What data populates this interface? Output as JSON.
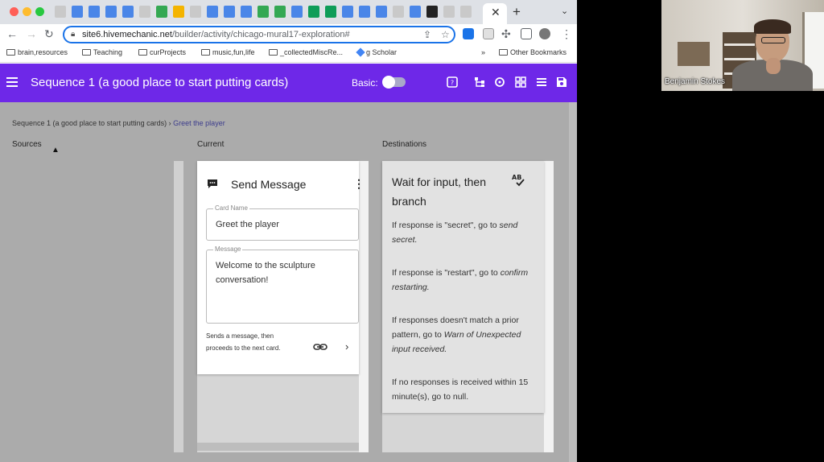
{
  "browser": {
    "url_host": "site6.hivemechanic.net",
    "url_path": "/builder/activity/chicago-mural17-exploration#",
    "bookmarks": [
      "brain,resources",
      "Teaching",
      "curProjects",
      "music,fun,life",
      "_collectedMiscRe...",
      "g Scholar",
      "»",
      "Other Bookmarks"
    ]
  },
  "app": {
    "title": "Sequence 1 (a good place to start putting cards)",
    "basic_label": "Basic:",
    "basic_toggle": "off",
    "accent_color": "#6e28e8"
  },
  "breadcrumb": {
    "parent": "Sequence 1 (a good place to start putting cards)",
    "separator": "›",
    "current": "Greet the player"
  },
  "columns": {
    "sources": "Sources",
    "current": "Current",
    "destinations": "Destinations"
  },
  "current_card": {
    "title": "Send Message",
    "icon": "chat-bubble-icon",
    "card_name_label": "Card Name",
    "card_name_value": "Greet the player",
    "message_label": "Message",
    "message_value": "Welcome to the sculpture conversation!",
    "description": "Sends a message, then proceeds to the next card."
  },
  "destination_card": {
    "title": "Wait for input, then branch",
    "icon": "ab-check-icon",
    "rules": [
      {
        "text": "If response is \"secret\", go to ",
        "target": "send secret."
      },
      {
        "text": "If response is \"restart\", go to ",
        "target": "confirm restarting."
      },
      {
        "text": "If responses doesn't match a prior pattern, go to ",
        "target": "Warn of Unexpected input received."
      },
      {
        "text": "If no responses is received within 15 minute(s), go to null.",
        "target": ""
      }
    ]
  },
  "webcam": {
    "participant_name": "Benjamin Stokes"
  }
}
